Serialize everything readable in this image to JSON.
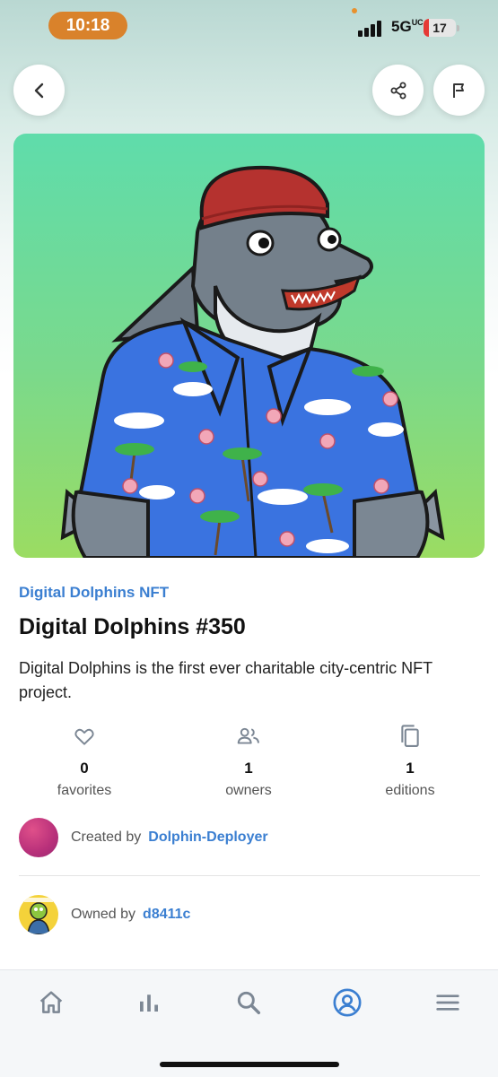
{
  "status_bar": {
    "time": "10:18",
    "network": "5G",
    "network_sup": "UC",
    "battery_level": "17",
    "battery_fraction": 0.17
  },
  "header": {
    "back_icon": "chevron-left-icon",
    "share_icon": "share-icon",
    "flag_icon": "flag-icon"
  },
  "nft": {
    "collection": "Digital Dolphins NFT",
    "title": "Digital Dolphins #350",
    "description": "Digital Dolphins is the first ever charitable city-centric NFT project."
  },
  "stats": [
    {
      "icon": "heart-icon",
      "value": "0",
      "label": "favorites"
    },
    {
      "icon": "people-icon",
      "value": "1",
      "label": "owners"
    },
    {
      "icon": "copy-icon",
      "value": "1",
      "label": "editions"
    }
  ],
  "creator": {
    "prefix": "Created by",
    "name": "Dolphin-Deployer"
  },
  "owner": {
    "prefix": "Owned by",
    "name": "d8411c"
  },
  "nav": {
    "items": [
      "home-icon",
      "stats-icon",
      "search-icon",
      "profile-icon",
      "menu-icon"
    ],
    "active_index": 3,
    "active_color": "#3b7fd1",
    "inactive_color": "#7c8794"
  },
  "colors": {
    "accent": "#3b7fd1",
    "time_pill": "#d9822b",
    "battery_low": "#e53935"
  }
}
